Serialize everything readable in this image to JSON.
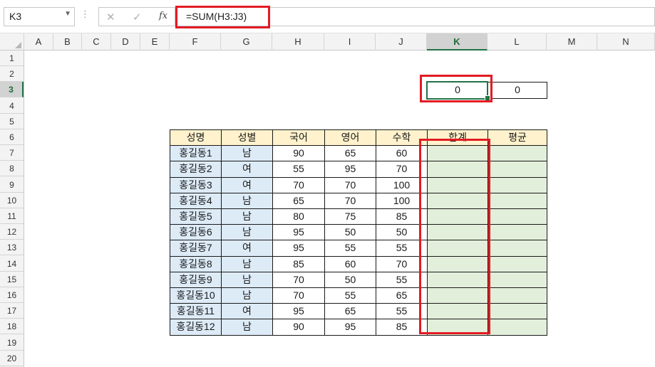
{
  "namebox": {
    "value": "K3"
  },
  "formula": {
    "text": "=SUM(H3:J3)"
  },
  "columns": [
    "A",
    "B",
    "C",
    "D",
    "E",
    "F",
    "G",
    "H",
    "I",
    "J",
    "K",
    "L",
    "M",
    "N"
  ],
  "rows": [
    "1",
    "2",
    "3",
    "4",
    "5",
    "6",
    "7",
    "8",
    "9",
    "10",
    "11",
    "12",
    "13",
    "14",
    "15",
    "16",
    "17",
    "18",
    "19",
    "20"
  ],
  "row3": {
    "k": "0",
    "l": "0"
  },
  "table": {
    "headers": [
      "성명",
      "성별",
      "국어",
      "영어",
      "수학",
      "합계",
      "평균"
    ],
    "rows": [
      [
        "홍길동1",
        "남",
        "90",
        "65",
        "60"
      ],
      [
        "홍길동2",
        "여",
        "55",
        "95",
        "70"
      ],
      [
        "홍길동3",
        "여",
        "70",
        "70",
        "100"
      ],
      [
        "홍길동4",
        "남",
        "65",
        "70",
        "100"
      ],
      [
        "홍길동5",
        "남",
        "80",
        "75",
        "85"
      ],
      [
        "홍길동6",
        "남",
        "95",
        "50",
        "50"
      ],
      [
        "홍길동7",
        "여",
        "95",
        "55",
        "55"
      ],
      [
        "홍길동8",
        "남",
        "85",
        "60",
        "70"
      ],
      [
        "홍길동9",
        "남",
        "70",
        "50",
        "55"
      ],
      [
        "홍길동10",
        "남",
        "70",
        "55",
        "65"
      ],
      [
        "홍길동11",
        "여",
        "95",
        "65",
        "55"
      ],
      [
        "홍길동12",
        "남",
        "90",
        "95",
        "85"
      ]
    ]
  },
  "colors": {
    "header_fill": "#fff2cc",
    "name_fill": "#ddebf7",
    "sum_fill": "#e2efda",
    "highlight": "#e31b23",
    "selection": "#217346"
  },
  "icons": [
    "dropdown-arrow-icon",
    "cancel-icon",
    "enter-icon",
    "function-icon"
  ]
}
